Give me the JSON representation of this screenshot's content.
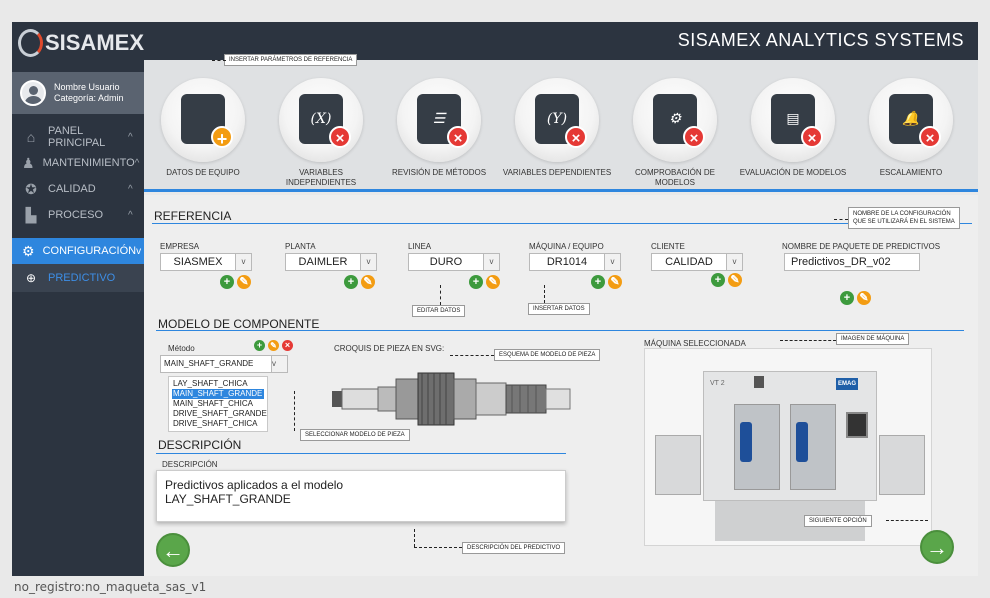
{
  "app": {
    "logo_text": "SISAMEX",
    "title": "SISAMEX ANALYTICS SYSTEMS"
  },
  "user": {
    "name": "Nombre Usuario",
    "role": "Categoría: Admin"
  },
  "sidebar": {
    "items": [
      {
        "label": "PANEL PRINCIPAL",
        "icon": "home-icon"
      },
      {
        "label": "MANTENIMIENTO",
        "icon": "workers-icon"
      },
      {
        "label": "CALIDAD",
        "icon": "award-icon"
      },
      {
        "label": "PROCESO",
        "icon": "factory-icon"
      }
    ],
    "active": {
      "label": "CONFIGURACIÓN",
      "icon": "gear-icon"
    },
    "sub": {
      "label": "PREDICTIVO",
      "icon": "plus-circle-icon"
    }
  },
  "steps": [
    {
      "label": "DATOS DE EQUIPO",
      "glyph": "",
      "badge": "+"
    },
    {
      "label": "VARIABLES INDEPENDIENTES",
      "glyph": "(X)",
      "badge": "×"
    },
    {
      "label": "REVISIÓN DE MÉTODOS",
      "glyph": "☰",
      "badge": "×"
    },
    {
      "label": "VARIABLES DEPENDIENTES",
      "glyph": "(Y)",
      "badge": "×"
    },
    {
      "label": "COMPROBACIÓN DE MODELOS",
      "glyph": "⚙",
      "badge": "×"
    },
    {
      "label": "EVALUACIÓN DE MODELOS",
      "glyph": "▤",
      "badge": "×"
    },
    {
      "label": "ESCALAMIENTO",
      "glyph": "🔔",
      "badge": "×"
    }
  ],
  "notes": {
    "insert_params": "INSERTAR PARÁMETROS DE REFERENCIA",
    "config_name_1": "NOMBRE DE LA CONFIGURACIÓN",
    "config_name_2": "QUE SE UTILIZARÁ EN EL SISTEMA",
    "edit_data": "EDITAR DATOS",
    "insert_data": "INSERTAR DATOS",
    "piece_schema": "ESQUEMA DE MODELO DE PIEZA",
    "machine_image": "IMAGEN DE MÁQUINA",
    "select_model": "SELECCIONAR MODELO DE PIEZA",
    "next_option": "SIGUIENTE OPCIÓN",
    "predictive_desc": "DESCRIPCIÓN DEL PREDICTIVO"
  },
  "referencia": {
    "heading": "REFERENCIA",
    "fields": [
      {
        "label": "EMPRESA",
        "value": "SIASMEX"
      },
      {
        "label": "PLANTA",
        "value": "DAIMLER"
      },
      {
        "label": "LINEA",
        "value": "DURO"
      },
      {
        "label": "MÁQUINA / EQUIPO",
        "value": "DR1014"
      },
      {
        "label": "CLIENTE",
        "value": "CALIDAD"
      }
    ],
    "package": {
      "label": "NOMBRE DE PAQUETE DE PREDICTIVOS",
      "value": "Predictivos_DR_v02"
    }
  },
  "modelo": {
    "heading": "MODELO DE COMPONENTE",
    "method_label": "Método",
    "method_value": "MAIN_SHAFT_GRANDE",
    "options": [
      "LAY_SHAFT_CHICA",
      "MAIN_SHAFT_GRANDE",
      "MAIN_SHAFT_CHICA",
      "DRIVE_SHAFT_GRANDE",
      "DRIVE_SHAFT_CHICA"
    ],
    "highlighted": 1,
    "sketch_label": "CROQUIS DE PIEZA EN SVG:",
    "machine_label": "MÁQUINA SELECCIONADA"
  },
  "descripcion": {
    "heading": "DESCRIPCIÓN",
    "label": "DESCRIPCIÓN",
    "line1": "Predictivos aplicados a el modelo",
    "line2": "LAY_SHAFT_GRANDE"
  },
  "machine": {
    "brand": "EMAG",
    "model": "VT 2"
  },
  "footer": "no_registro:no_maqueta_sas_v1",
  "colors": {
    "accent": "#2e86de",
    "sidebar": "#2c3440",
    "add": "#3d9a3d",
    "edit": "#f39c12",
    "delete": "#e53935"
  }
}
